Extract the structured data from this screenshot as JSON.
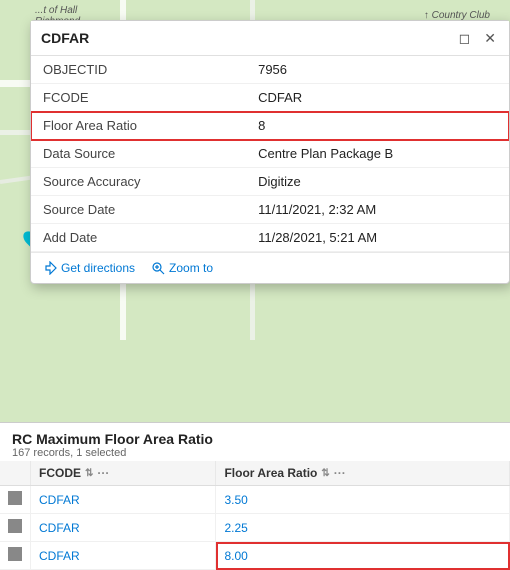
{
  "map": {
    "bg_color": "#d4e8c2"
  },
  "popup": {
    "title": "CDFAR",
    "minimize_label": "minimize",
    "close_label": "close",
    "attributes": [
      {
        "key": "OBJECTID",
        "value": "7956",
        "highlighted": false,
        "link": false
      },
      {
        "key": "FCODE",
        "value": "CDFAR",
        "highlighted": false,
        "link": false
      },
      {
        "key": "Floor Area Ratio",
        "value": "8",
        "highlighted": true,
        "link": false
      },
      {
        "key": "Data Source",
        "value": "Centre Plan Package B",
        "highlighted": false,
        "link": true
      },
      {
        "key": "Source Accuracy",
        "value": "Digitize",
        "highlighted": false,
        "link": true
      },
      {
        "key": "Source Date",
        "value": "11/11/2021, 2:32 AM",
        "highlighted": false,
        "link": false
      },
      {
        "key": "Add Date",
        "value": "11/28/2021, 5:21 AM",
        "highlighted": false,
        "link": false
      }
    ],
    "footer": {
      "get_directions": "Get directions",
      "zoom_to": "Zoom to"
    }
  },
  "table_panel": {
    "title": "RC Maximum Floor Area Ratio",
    "subtitle": "167 records, 1 selected",
    "columns": [
      {
        "label": "FCODE",
        "has_sort": true,
        "has_dots": true
      },
      {
        "label": "Floor Area Ratio",
        "has_sort": true,
        "has_dots": true
      }
    ],
    "rows": [
      {
        "fcode": "CDFAR",
        "far": "3.50",
        "highlighted": false
      },
      {
        "fcode": "CDFAR",
        "far": "2.25",
        "highlighted": false
      },
      {
        "fcode": "CDFAR",
        "far": "8.00",
        "highlighted": true
      }
    ]
  },
  "sidebar": {
    "icons": [
      "⇄",
      "⌂",
      "◧",
      "···"
    ]
  }
}
